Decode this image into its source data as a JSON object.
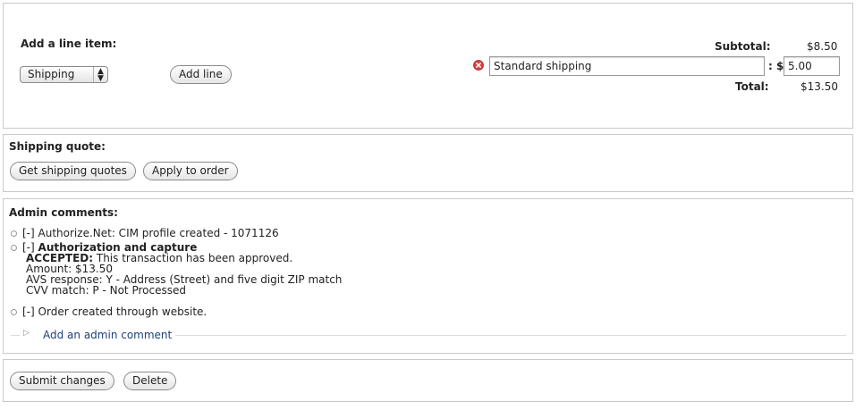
{
  "line_items": {
    "heading": "Add a line item:",
    "type_select_value": "Shipping",
    "add_line_label": "Add line",
    "shipping_line_title": "Standard shipping",
    "amount_separator": ": $",
    "shipping_amount": "5.00",
    "subtotal_label": "Subtotal:",
    "subtotal_value": "$8.50",
    "total_label": "Total:",
    "total_value": "$13.50"
  },
  "shipping_quote": {
    "heading": "Shipping quote:",
    "get_quotes_label": "Get shipping quotes",
    "apply_label": "Apply to order"
  },
  "admin_comments": {
    "heading": "Admin comments:",
    "comments": [
      {
        "toggle": "[-]",
        "text": "Authorize.Net: CIM profile created - 1071126"
      },
      {
        "toggle": "[-]",
        "title": "Authorization and capture",
        "status_label": "ACCEPTED:",
        "status_text": "This transaction has been approved.",
        "amount": "Amount: $13.50",
        "avs": "AVS response: Y - Address (Street) and five digit ZIP match",
        "cvv": "CVV match: P - Not Processed"
      },
      {
        "toggle": "[-]",
        "text": "Order created through website."
      }
    ],
    "add_comment_label": "Add an admin comment"
  },
  "actions": {
    "submit_label": "Submit changes",
    "delete_label": "Delete"
  },
  "colors": {
    "link": "#1f3e79",
    "remove_icon": "#d9423f",
    "border": "#c9c9c9"
  },
  "icons": {
    "remove": "remove-icon",
    "expand": "triangle-right-icon",
    "select_arrows": "select-arrows-icon"
  }
}
